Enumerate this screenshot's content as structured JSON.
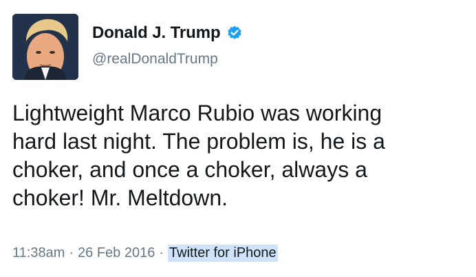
{
  "user": {
    "display_name": "Donald J. Trump",
    "handle": "@realDonaldTrump",
    "verified": true
  },
  "tweet": {
    "lines": [
      "Lightweight Marco Rubio was working",
      "hard last night. The problem is, he is a",
      "choker, and once a choker, always a",
      "choker! Mr. Meltdown."
    ]
  },
  "meta": {
    "time": "11:38am",
    "separator": "·",
    "date": "26 Feb 2016",
    "source": "Twitter for iPhone"
  },
  "colors": {
    "verified_badge": "#1da1f2",
    "secondary_text": "#657786",
    "source_highlight": "#cfe3fb"
  },
  "icons": {
    "avatar": "profile-photo",
    "verified": "verified-badge-icon"
  }
}
